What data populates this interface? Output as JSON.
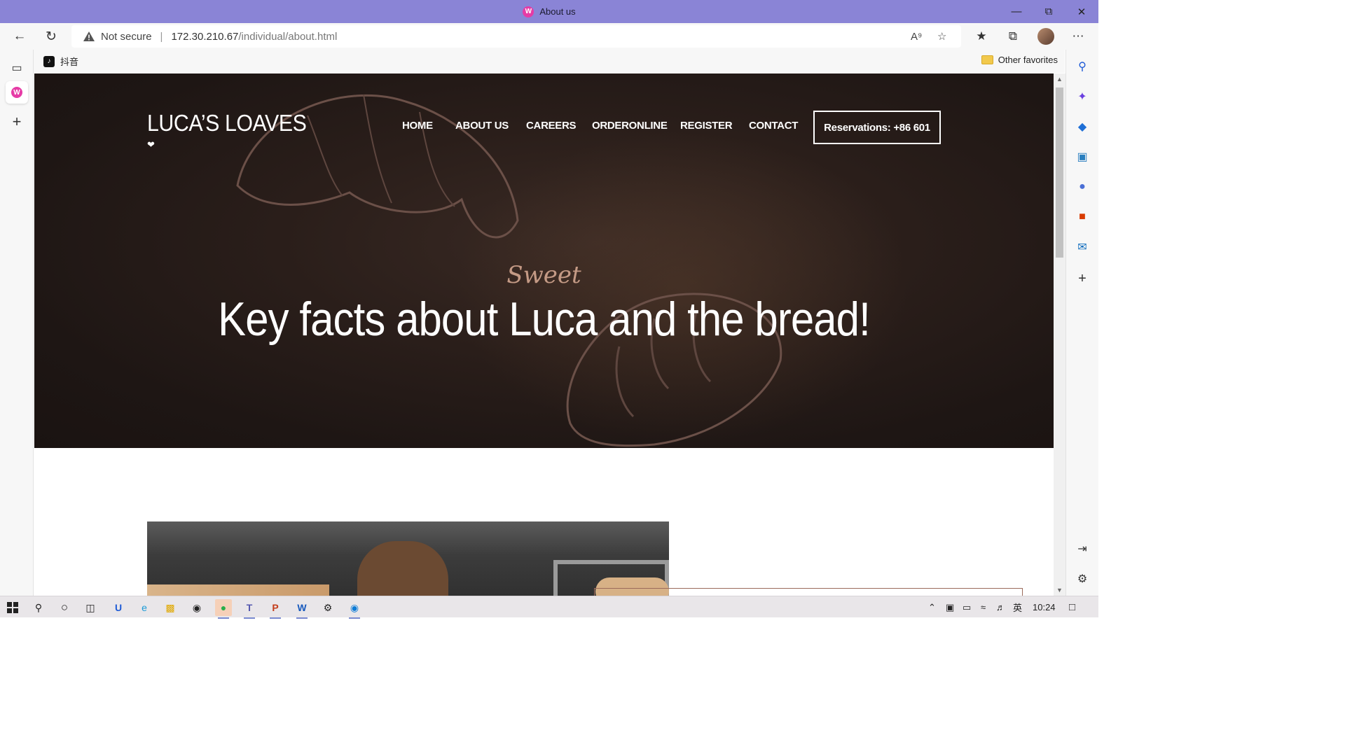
{
  "browser": {
    "tab_title": "About us",
    "security_label": "Not secure",
    "url_host": "172.30.210.67",
    "url_path": "/individual/about.html",
    "favorites_bar": {
      "items": [
        {
          "label": "抖音",
          "icon": "tiktok-icon"
        }
      ],
      "other_favorites": "Other favorites"
    },
    "window_controls": [
      "minimize-icon",
      "restore-icon",
      "close-icon"
    ]
  },
  "site": {
    "logo": "LUCA’S LOAVES",
    "nav": [
      "HOME",
      "ABOUT US",
      "CAREERS",
      "ORDERONLINE",
      "REGISTER",
      "CONTACT"
    ],
    "reservation": "Reservations: +86 601",
    "hero": {
      "script_word": "Sweet",
      "title": "Key facts about Luca and the bread!"
    }
  },
  "taskbar": {
    "time": "10:24",
    "ime": "英"
  },
  "colors": {
    "titlebar": "#8a84d6",
    "hero_bg": "#1e1614",
    "script_accent": "#c49a85"
  }
}
